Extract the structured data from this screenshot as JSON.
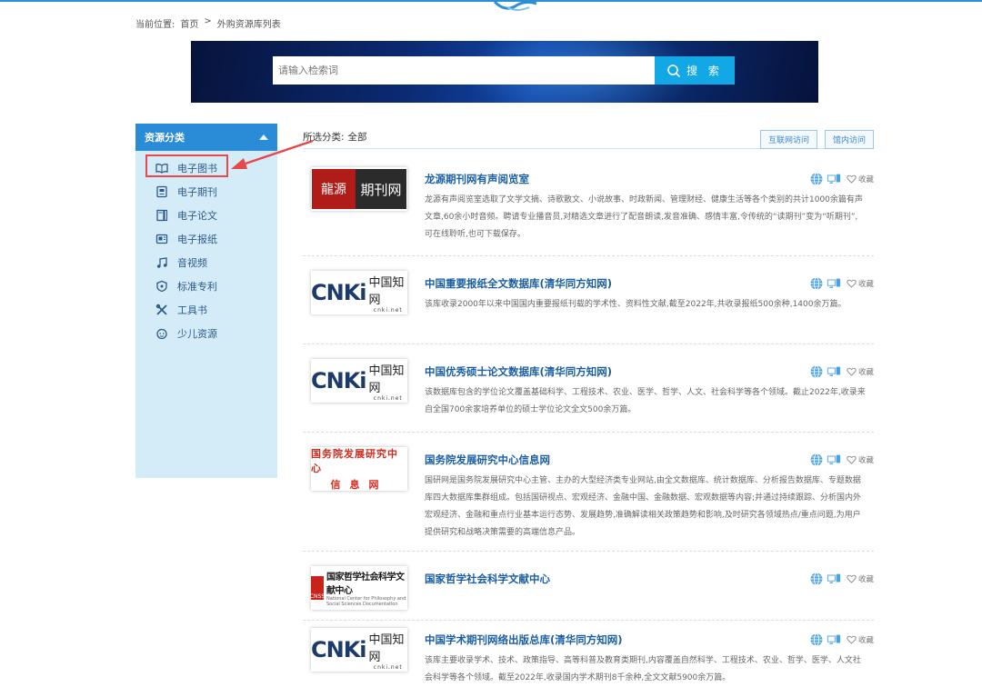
{
  "breadcrumb": {
    "label": "当前位置:",
    "home": "首页",
    "sep": ">",
    "current": "外购资源库列表"
  },
  "search": {
    "placeholder": "请输入检索词",
    "button_label": "搜 索"
  },
  "sidebar": {
    "title": "资源分类",
    "items": [
      {
        "label": "电子图书",
        "icon": "book-open-icon"
      },
      {
        "label": "电子期刊",
        "icon": "journal-icon"
      },
      {
        "label": "电子论文",
        "icon": "paper-icon"
      },
      {
        "label": "电子报纸",
        "icon": "newspaper-icon"
      },
      {
        "label": "音视频",
        "icon": "music-note-icon"
      },
      {
        "label": "标准专利",
        "icon": "shield-icon"
      },
      {
        "label": "工具书",
        "icon": "tools-icon"
      },
      {
        "label": "少儿资源",
        "icon": "child-face-icon"
      }
    ]
  },
  "filter": {
    "label": "所选分类:",
    "value": "全部",
    "btn_internet": "互联网访问",
    "btn_campus": "馆内访问"
  },
  "actions": {
    "favorite": "收藏"
  },
  "resources": [
    {
      "title": "龙源期刊网有声阅览室",
      "logo": "longyuan",
      "logo_text": [
        "龍源",
        "期刊网"
      ],
      "desc": "龙源有声阅览室选取了文学文摘、诗歌散文、小说故事、时政新闻、管理财经、健康生活等各个类别的共计1000余篇有声文章,60余小时音频。聘请专业播音员,对精选文章进行了配音朗读,发音准确、感情丰富,令传统的“读期刊”变为“听期刊”,可在线聆听,也可下载保存。"
    },
    {
      "title": "中国重要报纸全文数据库(清华同方知网)",
      "logo": "cnki",
      "logo_text": [
        "CNKi",
        "中国知网",
        "cnki.net"
      ],
      "desc": "该库收录2000年以来中国国内重要报纸刊载的学术性、资料性文献,截至2022年,共收录报纸500余种,1400余万篇。"
    },
    {
      "title": "中国优秀硕士论文数据库(清华同方知网)",
      "logo": "cnki",
      "logo_text": [
        "CNKi",
        "中国知网",
        "cnki.net"
      ],
      "desc": "该数据库包含的学位论文覆盖基础科学、工程技术、农业、医学、哲学、人文、社会科学等各个领域。截止2022年,收录来自全国700余家培养单位的硕士学位论文全文500余万篇。"
    },
    {
      "title": "国务院发展研究中心信息网",
      "logo": "drc",
      "logo_text": [
        "国务院发展研究中心",
        "信息网"
      ],
      "desc": "国研网是国务院发展研究中心主管、主办的大型经济类专业网站,由全文数据库、统计数据库、分析报告数据库、专题数据库四大数据库集群组成。包括国研视点、宏观经济、金融中国、金融数据、宏观数据等内容;并通过持续跟踪、分析国内外宏观经济、金融和重点行业基本运行态势、发展趋势,准确解读相关政策趋势和影响,及时研究各领域热点/重点问题,为用户提供研究和战略决策需要的高端信息产品。"
    },
    {
      "title": "国家哲学社会科学文献中心",
      "logo": "ncpssd",
      "logo_text": [
        "国家哲学社会科学文献中心",
        "National Center for Philosophy and Social Sciences Documentation",
        "CNSS"
      ],
      "desc": ""
    },
    {
      "title": "中国学术期刊网络出版总库(清华同方知网)",
      "logo": "cnki",
      "logo_text": [
        "CNKi",
        "中国知网",
        "cnki.net"
      ],
      "desc": "该库主要收录学术、技术、政策指导、高等科普及教育类期刊,内容覆盖自然科学、工程技术、农业、哲学、医学、人文社会科学等各个领域。截至2022年,收录国内学术期刊8千余种,全文文献5900余万篇。"
    }
  ],
  "colors": {
    "accent": "#2a8bd6",
    "title": "#1a5fa3",
    "highlight": "#e8484a",
    "search_button": "#12a8e6"
  }
}
